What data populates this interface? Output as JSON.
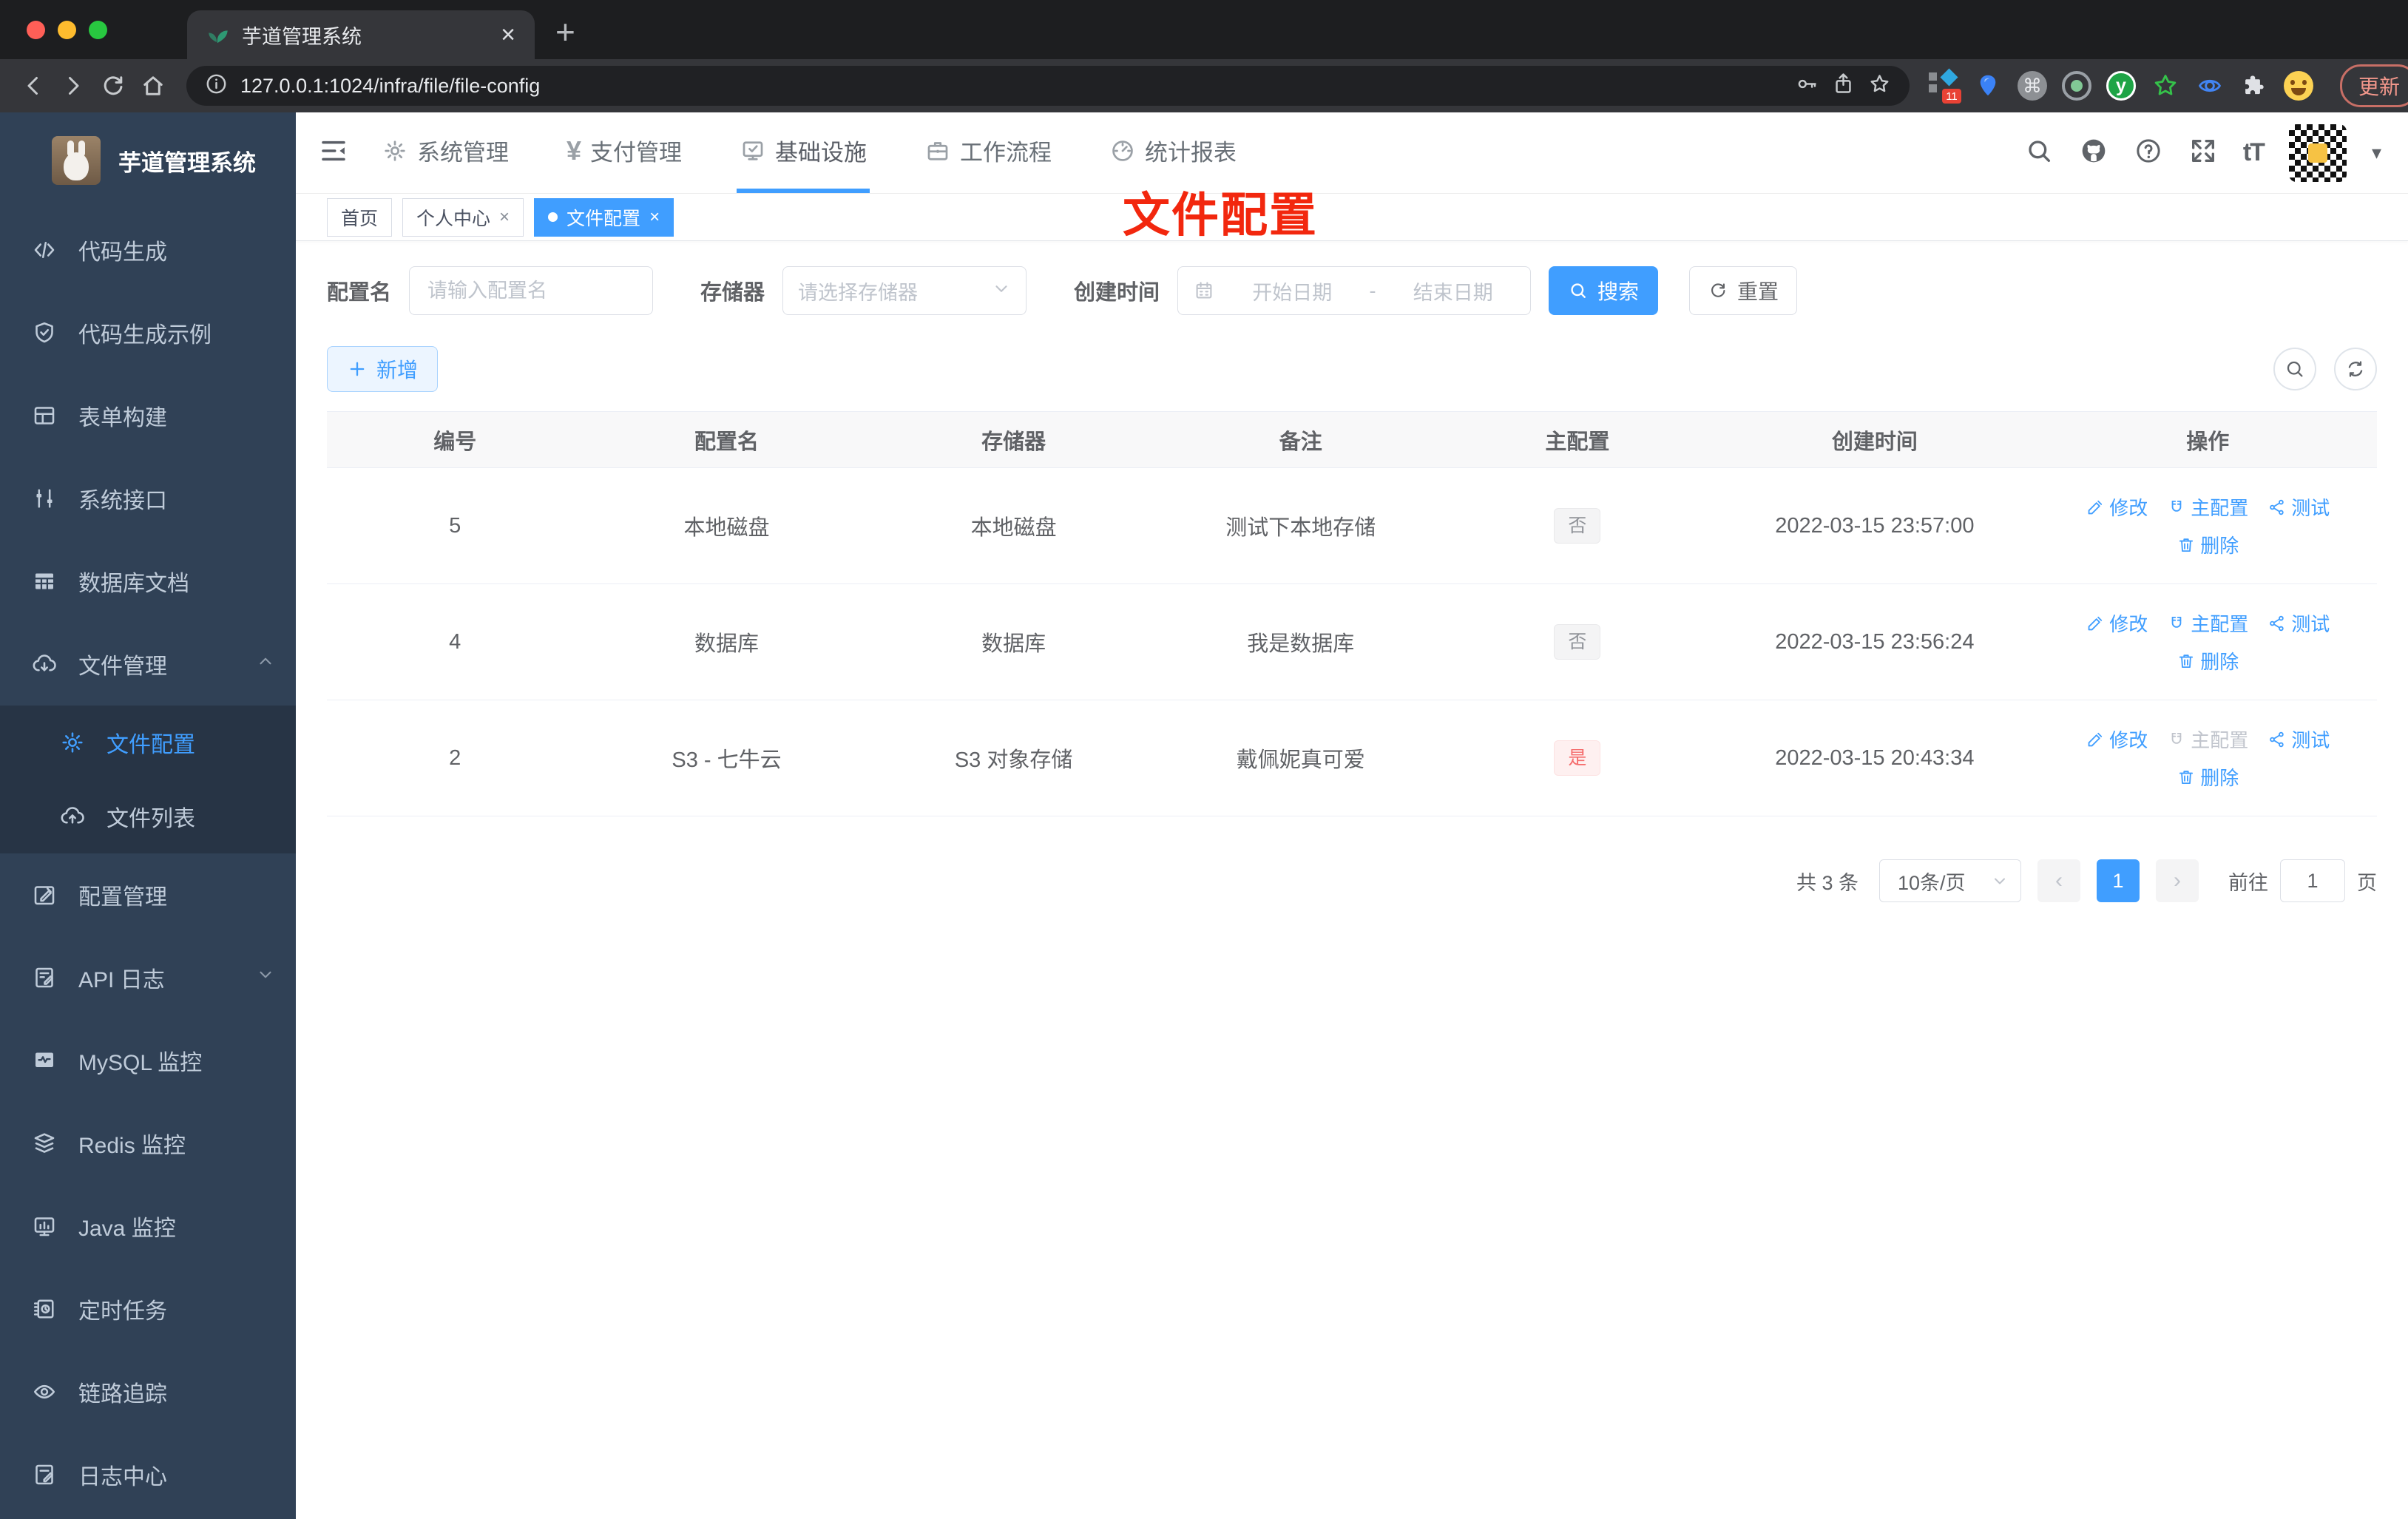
{
  "colors": {
    "accent": "#409eff",
    "danger": "#f56c6c",
    "annotation_red": "#f2270e",
    "sidebar_bg": "#304156"
  },
  "browser": {
    "tab_title": "芋道管理系统",
    "url": "127.0.0.1:1024/infra/file/file-config",
    "extension_badge": "11",
    "update_label": "更新"
  },
  "icons": {
    "cmd": "⌘",
    "text_size": "tT",
    "caret_down": "▾",
    "plus": "+",
    "close": "×",
    "prev": "‹",
    "next": "›",
    "kebab": "⋮"
  },
  "sidebar": {
    "title": "芋道管理系统",
    "items": [
      {
        "label": "代码生成"
      },
      {
        "label": "代码生成示例"
      },
      {
        "label": "表单构建"
      },
      {
        "label": "系统接口"
      },
      {
        "label": "数据库文档"
      },
      {
        "label": "文件管理"
      },
      {
        "label": "文件配置"
      },
      {
        "label": "文件列表"
      },
      {
        "label": "配置管理"
      },
      {
        "label": "API 日志"
      },
      {
        "label": "MySQL 监控"
      },
      {
        "label": "Redis 监控"
      },
      {
        "label": "Java 监控"
      },
      {
        "label": "定时任务"
      },
      {
        "label": "链路追踪"
      },
      {
        "label": "日志中心"
      }
    ]
  },
  "topnav": {
    "items": [
      {
        "label": "系统管理"
      },
      {
        "label": "支付管理"
      },
      {
        "label": "基础设施"
      },
      {
        "label": "工作流程"
      },
      {
        "label": "统计报表"
      }
    ],
    "yen": "¥"
  },
  "tags": {
    "items": [
      {
        "label": "首页"
      },
      {
        "label": "个人中心"
      },
      {
        "label": "文件配置"
      }
    ]
  },
  "annotation": {
    "text": "文件配置"
  },
  "filters": {
    "name_label": "配置名",
    "name_placeholder": "请输入配置名",
    "storage_label": "存储器",
    "storage_placeholder": "请选择存储器",
    "date_label": "创建时间",
    "date_start": "开始日期",
    "date_separator": "-",
    "date_end": "结束日期",
    "search_label": "搜索",
    "reset_label": "重置"
  },
  "toolbar": {
    "add_label": "新增"
  },
  "table": {
    "columns": [
      "编号",
      "配置名",
      "存储器",
      "备注",
      "主配置",
      "创建时间",
      "操作"
    ],
    "actions": {
      "edit": "修改",
      "master": "主配置",
      "test": "测试",
      "delete": "删除"
    },
    "rows": [
      {
        "id": "5",
        "name": "本地磁盘",
        "storage": "本地磁盘",
        "remark": "测试下本地存储",
        "master": "否",
        "created": "2022-03-15 23:57:00"
      },
      {
        "id": "4",
        "name": "数据库",
        "storage": "数据库",
        "remark": "我是数据库",
        "master": "否",
        "created": "2022-03-15 23:56:24"
      },
      {
        "id": "2",
        "name": "S3 - 七牛云",
        "storage": "S3 对象存储",
        "remark": "戴佩妮真可爱",
        "master": "是",
        "created": "2022-03-15 20:43:34"
      }
    ]
  },
  "pagination": {
    "total": "共 3 条",
    "page_size": "10条/页",
    "current_page": "1",
    "goto_label": "前往",
    "goto_value": "1",
    "page_suffix": "页"
  }
}
